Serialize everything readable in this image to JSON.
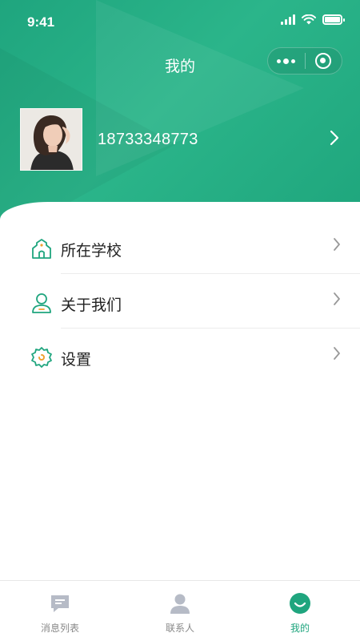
{
  "status_bar": {
    "time": "9:41"
  },
  "nav": {
    "title": "我的"
  },
  "profile": {
    "phone": "18733348773"
  },
  "menu": {
    "items": [
      {
        "label": "所在学校",
        "icon": "school-icon"
      },
      {
        "label": "关于我们",
        "icon": "person-icon"
      },
      {
        "label": "设置",
        "icon": "gear-icon"
      }
    ]
  },
  "tabbar": {
    "tabs": [
      {
        "label": "消息列表",
        "icon": "message-icon",
        "active": false
      },
      {
        "label": "联系人",
        "icon": "contacts-icon",
        "active": false
      },
      {
        "label": "我的",
        "icon": "me-icon",
        "active": true
      }
    ]
  },
  "colors": {
    "accent": "#1fa57e",
    "header": "#22aa80",
    "text": "#222222",
    "muted": "#888888"
  }
}
